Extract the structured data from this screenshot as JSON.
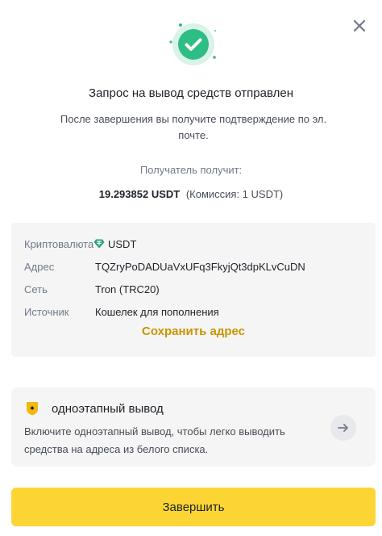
{
  "colors": {
    "success": "#2ebd85",
    "accent": "#fcd535",
    "link": "#c99400",
    "usdt": "#26a17b"
  },
  "dialog": {
    "close_icon": "close-icon",
    "status_icon": "check-circle-icon",
    "title": "Запрос на вывод средств отправлен",
    "subtitle": "После завершения вы получите подтверждение по эл. почте.",
    "receive_label": "Получатель получит:",
    "receive_amount": "19.293852 USDT",
    "receive_fee": "(Комиссия: 1 USDT)"
  },
  "details": {
    "rows": [
      {
        "label": "Криптовалюта",
        "value": "USDT",
        "icon": "usdt-coin-icon"
      },
      {
        "label": "Адрес",
        "value": "TQZryPoDADUaVxUFq3FkyjQt3dpKLvCuDN"
      },
      {
        "label": "Сеть",
        "value": "Tron (TRC20)"
      },
      {
        "label": "Источник",
        "value": "Кошелек для пополнения"
      }
    ],
    "save_address": "Сохранить адрес"
  },
  "promo": {
    "icon": "shield-icon",
    "title": "одноэтапный вывод",
    "description": "Включите одноэтапный вывод, чтобы легко выводить средства на адреса из белого списка.",
    "arrow_icon": "arrow-right-icon"
  },
  "footer": {
    "finish_label": "Завершить"
  }
}
